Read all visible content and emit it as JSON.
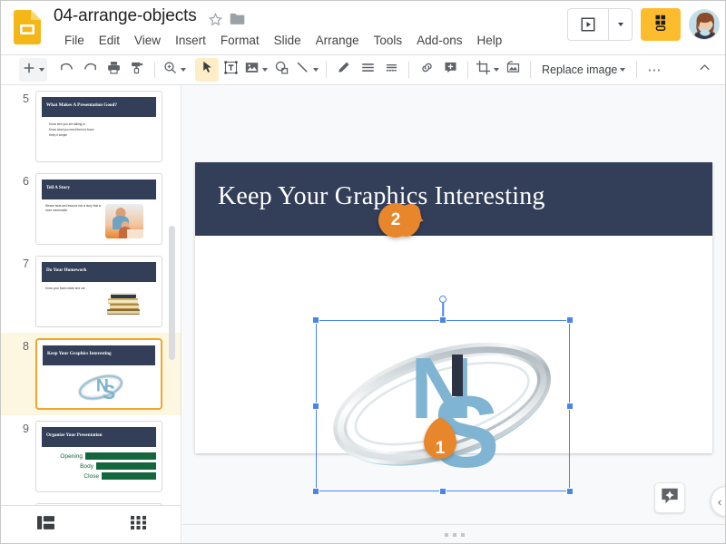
{
  "app": {
    "name": "Google Slides",
    "logo_icon": "slides-logo-icon"
  },
  "header": {
    "doc_title": "04-arrange-objects",
    "star_icon": "star-outline-icon",
    "folder_icon": "folder-icon",
    "menus": [
      "File",
      "Edit",
      "View",
      "Insert",
      "Format",
      "Slide",
      "Arrange",
      "Tools",
      "Add-ons",
      "Help"
    ],
    "present_label": "Present",
    "present_icon": "present-play-icon",
    "present_dropdown_icon": "chevron-down-icon",
    "share_label": "Share",
    "share_icon": "share-lock-icon",
    "share_color": "#fdbc2d",
    "avatar_name": "user-avatar"
  },
  "toolbar": {
    "items": [
      {
        "name": "new-slide-button",
        "icon": "plus-icon",
        "has_caret": true,
        "active": false
      },
      {
        "name": "undo-button",
        "icon": "undo-icon",
        "has_caret": false,
        "active": false
      },
      {
        "name": "redo-button",
        "icon": "redo-icon",
        "has_caret": false,
        "active": false
      },
      {
        "name": "print-button",
        "icon": "printer-icon",
        "has_caret": false,
        "active": false
      },
      {
        "name": "paint-format-button",
        "icon": "paint-roller-icon",
        "has_caret": false,
        "active": false
      },
      {
        "name": "zoom-button",
        "icon": "magnifier-icon",
        "has_caret": true,
        "active": false
      },
      {
        "name": "select-tool-button",
        "icon": "cursor-arrow-icon",
        "has_caret": false,
        "active": true
      },
      {
        "name": "text-box-button",
        "icon": "text-box-icon",
        "has_caret": false,
        "active": false
      },
      {
        "name": "insert-image-button",
        "icon": "image-icon",
        "has_caret": true,
        "active": false
      },
      {
        "name": "shape-button",
        "icon": "shape-icon",
        "has_caret": false,
        "active": false
      },
      {
        "name": "line-button",
        "icon": "line-icon",
        "has_caret": true,
        "active": false
      },
      {
        "name": "pen-button",
        "icon": "pencil-icon",
        "has_caret": false,
        "active": false
      },
      {
        "name": "align-button",
        "icon": "align-lines-icon",
        "has_caret": false,
        "active": false
      },
      {
        "name": "line-spacing-button",
        "icon": "line-spacing-icon",
        "has_caret": false,
        "active": false
      },
      {
        "name": "insert-link-button",
        "icon": "link-icon",
        "has_caret": false,
        "active": false
      },
      {
        "name": "add-comment-button",
        "icon": "comment-plus-icon",
        "has_caret": false,
        "active": false
      },
      {
        "name": "crop-image-button",
        "icon": "crop-icon",
        "has_caret": true,
        "active": false
      },
      {
        "name": "mask-image-button",
        "icon": "mask-image-icon",
        "has_caret": false,
        "active": false
      }
    ],
    "replace_image_label": "Replace image",
    "more_options_icon": "ellipsis-icon",
    "collapse_toolbar_icon": "chevron-up-icon"
  },
  "sidebar": {
    "scrollbar": "vertical-scrollbar",
    "footer": {
      "filmstrip_icon": "filmstrip-view-icon",
      "grid_icon": "grid-view-icon"
    },
    "slides": [
      {
        "number": "5",
        "title": "What Makes A Presentation Good?",
        "selected": false,
        "layout": "bullets",
        "bullets": [
          "Know who you are talking to",
          "Know what you need them to know",
          "Keep it simple"
        ]
      },
      {
        "number": "6",
        "title": "Tell A Story",
        "selected": false,
        "layout": "text-photo",
        "body": "Weave facts and lessons into a story that is more memorable",
        "photo": "family-reading-photo"
      },
      {
        "number": "7",
        "title": "Do Your Homework",
        "selected": false,
        "layout": "text-photo",
        "body": "Know your facts inside and out",
        "photo": "stack-of-books-photo"
      },
      {
        "number": "8",
        "title": "Keep Your Graphics Interesting",
        "selected": true,
        "layout": "logo",
        "photo": "ns-logo-image"
      },
      {
        "number": "9",
        "title": "Organize Your Presentation",
        "selected": false,
        "layout": "bars",
        "bars": [
          {
            "label": "Opening",
            "width": 78
          },
          {
            "label": "Body",
            "width": 66
          },
          {
            "label": "Close",
            "width": 60
          }
        ],
        "bar_color": "#14663c"
      }
    ]
  },
  "canvas": {
    "slide_title": "Keep Your Graphics Interesting",
    "title_bar_color": "#333e58",
    "selected_object": {
      "name": "ns-logo-image",
      "selected": true,
      "handles": 8,
      "rotation_handle": true,
      "selection_color": "#4a86e8"
    },
    "callouts": [
      {
        "number": "1",
        "shape": "pin-up",
        "color": "#e8862c"
      },
      {
        "number": "2",
        "shape": "pin-left",
        "color": "#e8862c"
      }
    ],
    "explore_icon": "explore-star-icon",
    "collapse_panel_icon": "chevron-left-icon",
    "notes_grip": "notes-drag-handle"
  }
}
